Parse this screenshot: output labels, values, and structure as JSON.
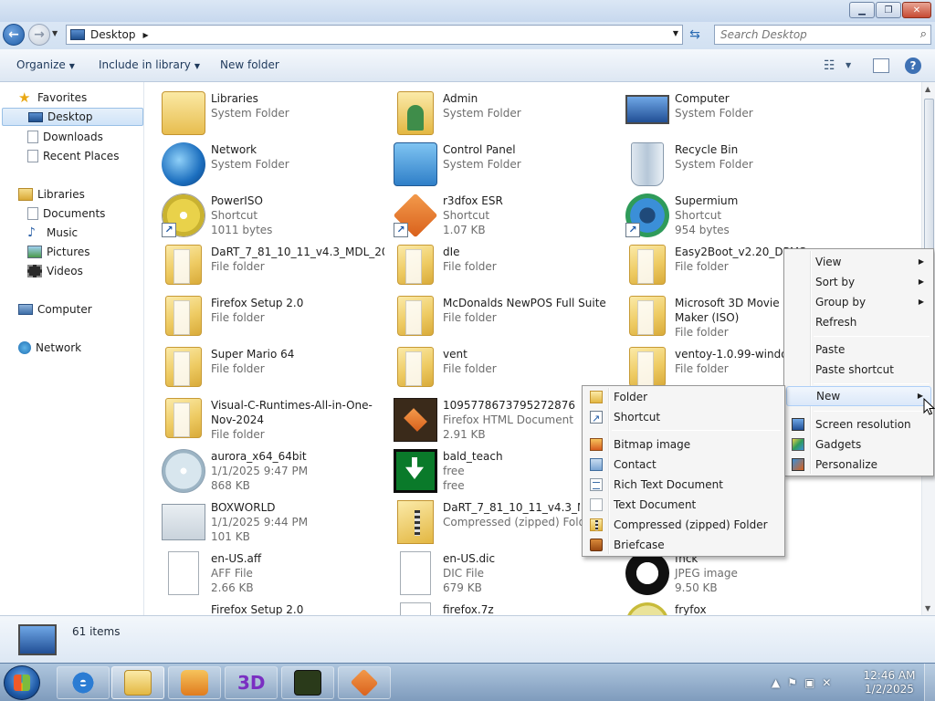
{
  "window": {
    "min": "▁",
    "max": "❐",
    "close": "✕"
  },
  "address": {
    "crumb": "Desktop",
    "search_placeholder": "Search Desktop"
  },
  "toolbar": {
    "organize": "Organize",
    "include": "Include in library",
    "new_folder": "New folder"
  },
  "nav": {
    "favorites": "Favorites",
    "desktop": "Desktop",
    "downloads": "Downloads",
    "recent": "Recent Places",
    "libraries": "Libraries",
    "documents": "Documents",
    "music": "Music",
    "pictures": "Pictures",
    "videos": "Videos",
    "computer": "Computer",
    "network": "Network"
  },
  "items": [
    {
      "name": "Libraries",
      "l2": "System Folder"
    },
    {
      "name": "Admin",
      "l2": "System Folder"
    },
    {
      "name": "Computer",
      "l2": "System Folder"
    },
    {
      "name": "Network",
      "l2": "System Folder"
    },
    {
      "name": "Control Panel",
      "l2": "System Folder"
    },
    {
      "name": "Recycle Bin",
      "l2": "System Folder"
    },
    {
      "name": "PowerISO",
      "l2": "Shortcut",
      "l3": "1011 bytes"
    },
    {
      "name": "r3dfox ESR",
      "l2": "Shortcut",
      "l3": "1.07 KB"
    },
    {
      "name": "Supermium",
      "l2": "Shortcut",
      "l3": "954 bytes"
    },
    {
      "name": "DaRT_7_81_10_11_v4.3_MDL_2024",
      "l2": "File folder"
    },
    {
      "name": "dIe",
      "l2": "File folder"
    },
    {
      "name": "Easy2Boot_v2.20_DPMS",
      "l2": "File folder"
    },
    {
      "name": "Firefox Setup 2.0",
      "l2": "File folder"
    },
    {
      "name": "McDonalds NewPOS Full Suite",
      "l2": "File folder"
    },
    {
      "name": "Microsoft 3D Movie Maker (ISO)",
      "l2": "File folder"
    },
    {
      "name": "Super Mario 64",
      "l2": "File folder"
    },
    {
      "name": "vent",
      "l2": "File folder"
    },
    {
      "name": "ventoy-1.0.99-windows",
      "l2": "File folder"
    },
    {
      "name": "Visual-C-Runtimes-All-in-One-Nov-2024",
      "l2": "File folder"
    },
    {
      "name": "1095778673795272876",
      "l2": "Firefox HTML Document",
      "l3": "2.91 KB"
    },
    {
      "name": "aurora_x64_64bit",
      "l2": "1/1/2025 9:47 PM",
      "l3": "868 KB"
    },
    {
      "name": "bald_teach",
      "l2": "free",
      "l3": "free"
    },
    {
      "name": "BOXWORLD",
      "l2": "1/1/2025 9:44 PM",
      "l3": "101 KB"
    },
    {
      "name": "DaRT_7_81_10_11_v4.3_MDL_2024",
      "l2": "Compressed (zipped) Folder"
    },
    {
      "name": "en-US.aff",
      "l2": "AFF File",
      "l3": "2.66 KB"
    },
    {
      "name": "en-US.dic",
      "l2": "DIC File",
      "l3": "679 KB"
    },
    {
      "name": "fnck",
      "l2": "JPEG image",
      "l3": "9.50 KB"
    },
    {
      "name": "Firefox Setup 2.0",
      "l2": ""
    },
    {
      "name": "firefox.7z",
      "l2": ""
    },
    {
      "name": "fryfox",
      "l2": ""
    }
  ],
  "status": {
    "count": "61 items"
  },
  "context_menu": {
    "view": "View",
    "sort_by": "Sort by",
    "group_by": "Group by",
    "refresh": "Refresh",
    "paste": "Paste",
    "paste_shortcut": "Paste shortcut",
    "new": "New",
    "screen_resolution": "Screen resolution",
    "gadgets": "Gadgets",
    "personalize": "Personalize"
  },
  "new_submenu": {
    "folder": "Folder",
    "shortcut": "Shortcut",
    "bitmap": "Bitmap image",
    "contact": "Contact",
    "rtf": "Rich Text Document",
    "txt": "Text Document",
    "zip": "Compressed (zipped) Folder",
    "briefcase": "Briefcase"
  },
  "clock": {
    "time": "12:46 AM",
    "date": "1/2/2025"
  },
  "colors": {
    "accent": "#2b6cb3",
    "selection": "#cfe3f8",
    "menu_highlight": "#dbe8f9"
  }
}
